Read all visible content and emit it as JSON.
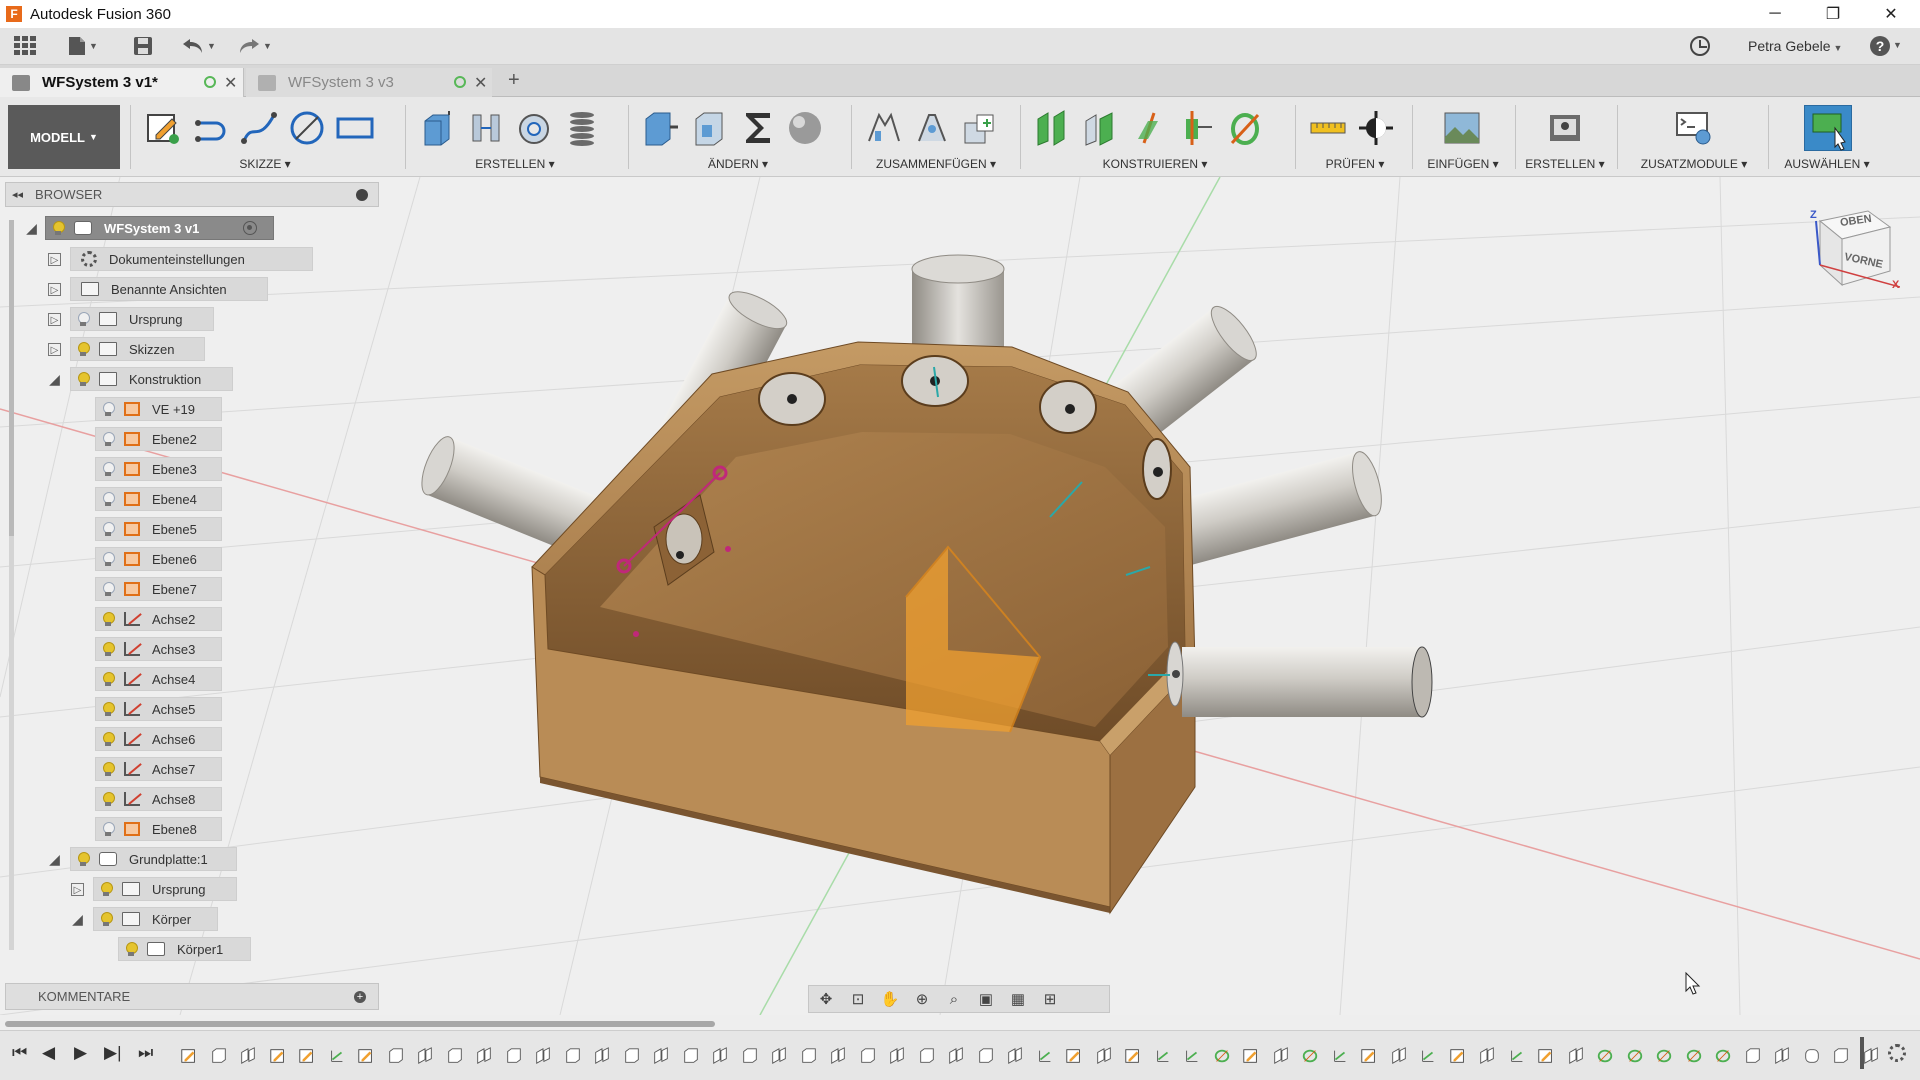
{
  "app": {
    "title": "Autodesk Fusion 360"
  },
  "window_controls": {
    "minimize": "─",
    "restore": "❐",
    "close": "✕"
  },
  "quick_access": {
    "user": "Petra Gebele",
    "help": "?"
  },
  "tabs": [
    {
      "label": "WFSystem 3 v1*",
      "active": true
    },
    {
      "label": "WFSystem 3 v3",
      "active": false
    }
  ],
  "ribbon": {
    "workspace": "MODELL",
    "groups": [
      {
        "label": "SKIZZE"
      },
      {
        "label": "ERSTELLEN"
      },
      {
        "label": "ÄNDERN"
      },
      {
        "label": "ZUSAMMENFÜGEN"
      },
      {
        "label": "KONSTRUIEREN"
      },
      {
        "label": "PRÜFEN"
      },
      {
        "label": "EINFÜGEN"
      },
      {
        "label": "ERSTELLEN"
      },
      {
        "label": "ZUSATZMODULE"
      },
      {
        "label": "AUSWÄHLEN"
      }
    ]
  },
  "browser": {
    "title": "BROWSER",
    "root": "WFSystem 3 v1",
    "items": [
      {
        "label": "Dokumenteinstellungen"
      },
      {
        "label": "Benannte Ansichten"
      },
      {
        "label": "Ursprung"
      },
      {
        "label": "Skizzen"
      },
      {
        "label": "Konstruktion"
      },
      {
        "label": "VE +19"
      },
      {
        "label": "Ebene2"
      },
      {
        "label": "Ebene3"
      },
      {
        "label": "Ebene4"
      },
      {
        "label": "Ebene5"
      },
      {
        "label": "Ebene6"
      },
      {
        "label": "Ebene7"
      },
      {
        "label": "Achse2"
      },
      {
        "label": "Achse3"
      },
      {
        "label": "Achse4"
      },
      {
        "label": "Achse5"
      },
      {
        "label": "Achse6"
      },
      {
        "label": "Achse7"
      },
      {
        "label": "Achse8"
      },
      {
        "label": "Ebene8"
      },
      {
        "label": "Grundplatte:1"
      },
      {
        "label": "Ursprung"
      },
      {
        "label": "Körper"
      },
      {
        "label": "Körper1"
      }
    ]
  },
  "comments": {
    "title": "KOMMENTARE"
  },
  "viewcube": {
    "top": "OBEN",
    "front": "VORNE",
    "axis_z": "Z",
    "axis_x": "X"
  },
  "colors": {
    "accent": "#e07018",
    "wood": "#b78a55",
    "pipe": "#c9c6bf",
    "selection": "#c0287a",
    "workspace": "#5a5a5a"
  }
}
